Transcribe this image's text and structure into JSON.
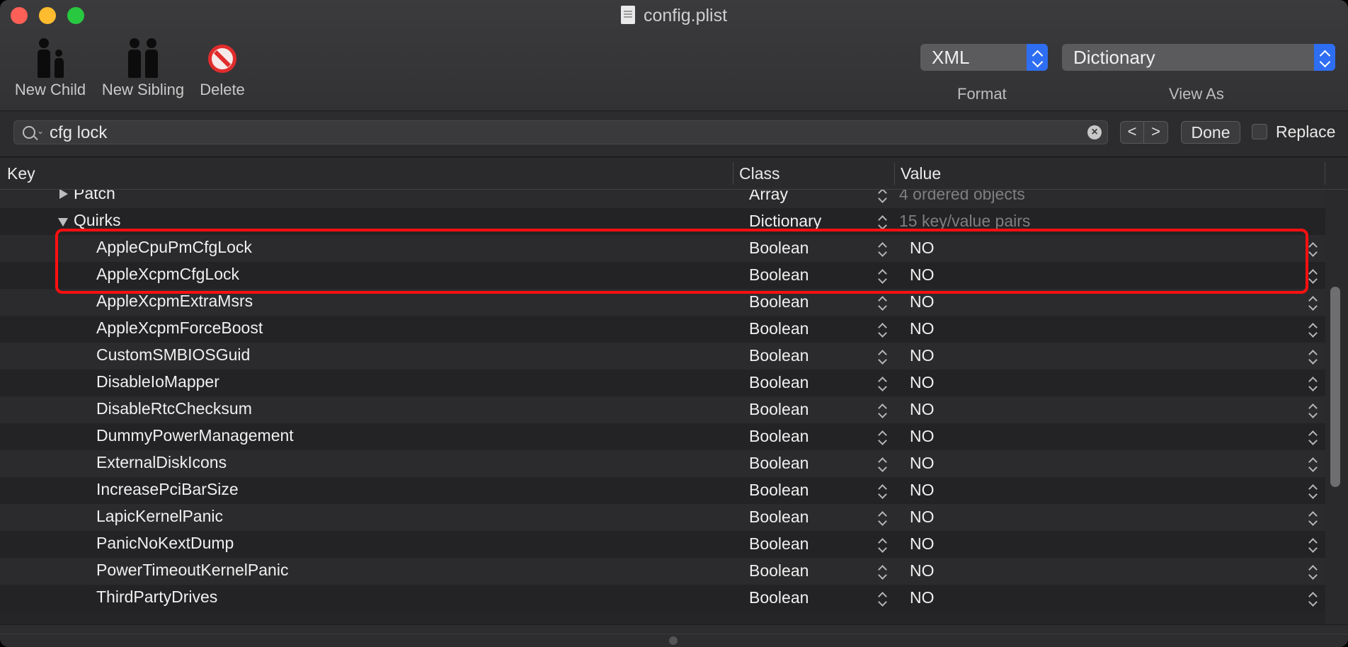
{
  "window": {
    "title": "config.plist"
  },
  "toolbar": {
    "new_child": "New Child",
    "new_sibling": "New Sibling",
    "delete": "Delete",
    "format_value": "XML",
    "format_label": "Format",
    "view_as_value": "Dictionary",
    "view_as_label": "View As"
  },
  "search": {
    "value": "cfg lock",
    "prev": "<",
    "next": ">",
    "done": "Done",
    "replace_label": "Replace",
    "replace_checked": false
  },
  "table": {
    "headers": {
      "key": "Key",
      "class": "Class",
      "value": "Value"
    },
    "rows": [
      {
        "key": "Patch",
        "class": "Array",
        "value": "4 ordered objects",
        "indent": 1,
        "disclosure": "collapsed",
        "dim": true
      },
      {
        "key": "Quirks",
        "class": "Dictionary",
        "value": "15 key/value pairs",
        "indent": 1,
        "disclosure": "expanded",
        "dim": true
      },
      {
        "key": "AppleCpuPmCfgLock",
        "class": "Boolean",
        "value": "NO",
        "indent": 2
      },
      {
        "key": "AppleXcpmCfgLock",
        "class": "Boolean",
        "value": "NO",
        "indent": 2
      },
      {
        "key": "AppleXcpmExtraMsrs",
        "class": "Boolean",
        "value": "NO",
        "indent": 2
      },
      {
        "key": "AppleXcpmForceBoost",
        "class": "Boolean",
        "value": "NO",
        "indent": 2
      },
      {
        "key": "CustomSMBIOSGuid",
        "class": "Boolean",
        "value": "NO",
        "indent": 2
      },
      {
        "key": "DisableIoMapper",
        "class": "Boolean",
        "value": "NO",
        "indent": 2
      },
      {
        "key": "DisableRtcChecksum",
        "class": "Boolean",
        "value": "NO",
        "indent": 2
      },
      {
        "key": "DummyPowerManagement",
        "class": "Boolean",
        "value": "NO",
        "indent": 2
      },
      {
        "key": "ExternalDiskIcons",
        "class": "Boolean",
        "value": "NO",
        "indent": 2
      },
      {
        "key": "IncreasePciBarSize",
        "class": "Boolean",
        "value": "NO",
        "indent": 2
      },
      {
        "key": "LapicKernelPanic",
        "class": "Boolean",
        "value": "NO",
        "indent": 2
      },
      {
        "key": "PanicNoKextDump",
        "class": "Boolean",
        "value": "NO",
        "indent": 2
      },
      {
        "key": "PowerTimeoutKernelPanic",
        "class": "Boolean",
        "value": "NO",
        "indent": 2
      },
      {
        "key": "ThirdPartyDrives",
        "class": "Boolean",
        "value": "NO",
        "indent": 2
      }
    ]
  },
  "colors": {
    "highlight": "#ff1010",
    "accent": "#2e6ef3"
  }
}
